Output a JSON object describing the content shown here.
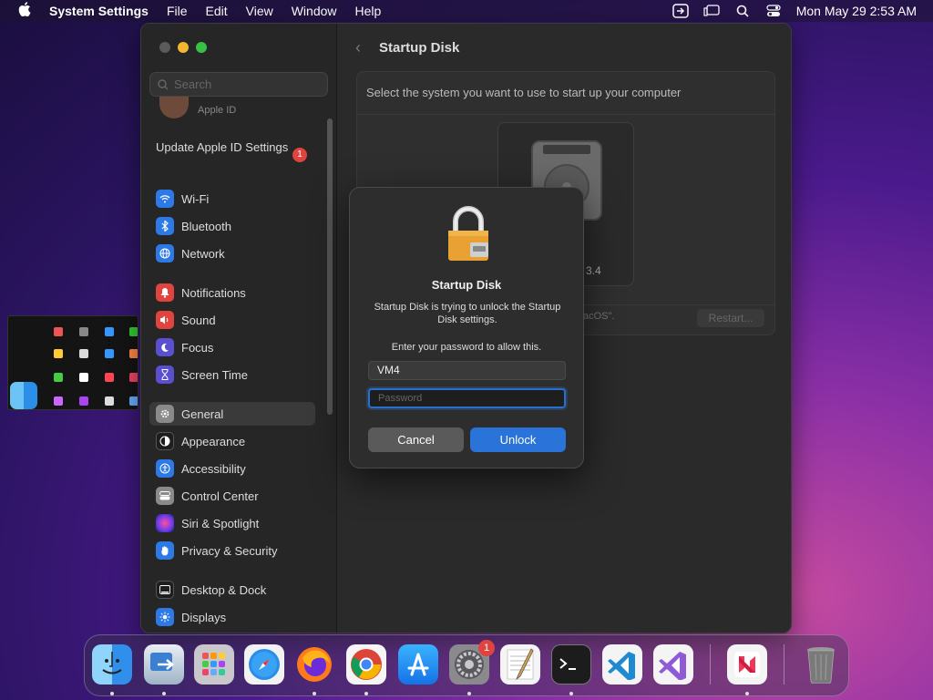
{
  "menubar": {
    "app_name": "System Settings",
    "menus": [
      "File",
      "Edit",
      "View",
      "Window",
      "Help"
    ],
    "clock": "Mon May 29  2:53 AM"
  },
  "sidebar": {
    "search_placeholder": "Search",
    "apple_id_label": "Apple ID",
    "update_label": "Update Apple ID Settings",
    "update_badge": "1",
    "items": [
      {
        "label": "Wi-Fi",
        "icon": "wifi-icon",
        "color": "#2d7ae6"
      },
      {
        "label": "Bluetooth",
        "icon": "bluetooth-icon",
        "color": "#2d7ae6"
      },
      {
        "label": "Network",
        "icon": "globe-icon",
        "color": "#2d7ae6"
      },
      {
        "label": "Notifications",
        "icon": "bell-icon",
        "color": "#e0443e"
      },
      {
        "label": "Sound",
        "icon": "speaker-icon",
        "color": "#e0443e"
      },
      {
        "label": "Focus",
        "icon": "moon-icon",
        "color": "#5a4fcf"
      },
      {
        "label": "Screen Time",
        "icon": "hourglass-icon",
        "color": "#5a4fcf"
      },
      {
        "label": "General",
        "icon": "gear-icon",
        "color": "#8a8a8a"
      },
      {
        "label": "Appearance",
        "icon": "appearance-icon",
        "color": "#1e1e1e"
      },
      {
        "label": "Accessibility",
        "icon": "accessibility-icon",
        "color": "#2d7ae6"
      },
      {
        "label": "Control Center",
        "icon": "control-center-icon",
        "color": "#8a8a8a"
      },
      {
        "label": "Siri & Spotlight",
        "icon": "siri-icon",
        "color": "#b04fd0"
      },
      {
        "label": "Privacy & Security",
        "icon": "hand-icon",
        "color": "#2d7ae6"
      },
      {
        "label": "Desktop & Dock",
        "icon": "dock-icon",
        "color": "#1e1e1e"
      },
      {
        "label": "Displays",
        "icon": "sun-icon",
        "color": "#2d7ae6"
      }
    ]
  },
  "main": {
    "title": "Startup Disk",
    "description": "Select the system you want to use to start up your computer",
    "disk_label_fragment": "3.4",
    "footer_label_fragment": "acOS\".",
    "restart_label": "Restart..."
  },
  "dialog": {
    "title": "Startup Disk",
    "message": "Startup Disk is trying to unlock the Startup Disk settings.",
    "prompt": "Enter your password to allow this.",
    "username_value": "VM4",
    "password_placeholder": "Password",
    "cancel_label": "Cancel",
    "unlock_label": "Unlock"
  },
  "dock": {
    "update_badge": "1",
    "apps": [
      {
        "name": "Finder",
        "icon": "finder-icon"
      },
      {
        "name": "Migration Assistant",
        "icon": "migration-icon"
      },
      {
        "name": "Launchpad",
        "icon": "launchpad-icon"
      },
      {
        "name": "Safari",
        "icon": "safari-icon"
      },
      {
        "name": "Firefox",
        "icon": "firefox-icon"
      },
      {
        "name": "Chrome",
        "icon": "chrome-icon"
      },
      {
        "name": "App Store",
        "icon": "app-store-icon"
      },
      {
        "name": "System Settings",
        "icon": "system-settings-icon"
      },
      {
        "name": "TextEdit",
        "icon": "textedit-icon"
      },
      {
        "name": "Terminal",
        "icon": "terminal-icon"
      },
      {
        "name": "VS Code",
        "icon": "vscode-icon"
      },
      {
        "name": "Visual Studio",
        "icon": "visual-studio-icon"
      },
      {
        "name": "News",
        "icon": "news-icon"
      },
      {
        "name": "Trash",
        "icon": "trash-icon"
      }
    ]
  }
}
